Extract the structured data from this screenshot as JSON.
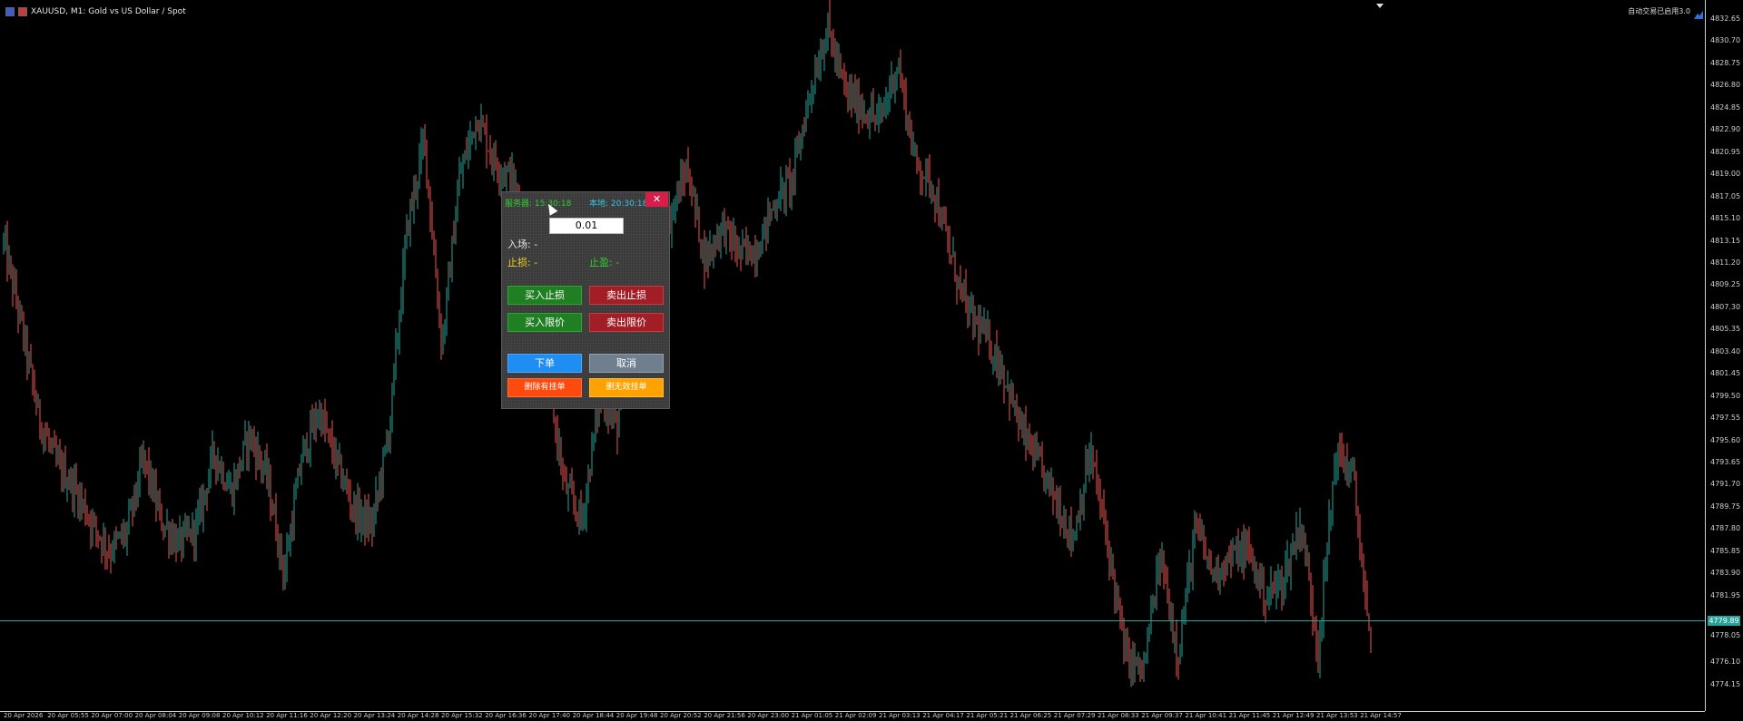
{
  "window": {
    "title": "XAUUSD, M1:  Gold vs US Dollar / Spot"
  },
  "toolbar": {
    "right_label": "自动交易已启用3.0"
  },
  "colors": {
    "bull": "#26a69a",
    "bear": "#ef5350",
    "price_line": "#2aa198",
    "background": "#000000"
  },
  "price_scale": {
    "labels": [
      "4832.65",
      "4830.70",
      "4828.75",
      "4826.80",
      "4824.85",
      "4822.90",
      "4820.95",
      "4819.00",
      "4817.05",
      "4815.10",
      "4813.15",
      "4811.20",
      "4809.25",
      "4807.30",
      "4805.35",
      "4803.40",
      "4801.45",
      "4799.50",
      "4797.55",
      "4795.60",
      "4793.65",
      "4791.70",
      "4789.75",
      "4787.80",
      "4785.85",
      "4783.90",
      "4781.95",
      "4778.05",
      "4776.10",
      "4774.15"
    ],
    "current_price": "4779.89"
  },
  "time_scale": {
    "labels": [
      "20 Apr 2026",
      "20 Apr 05:55",
      "20 Apr 07:00",
      "20 Apr 08:04",
      "20 Apr 09:08",
      "20 Apr 10:12",
      "20 Apr 11:16",
      "20 Apr 12:20",
      "20 Apr 13:24",
      "20 Apr 14:28",
      "20 Apr 15:32",
      "20 Apr 16:36",
      "20 Apr 17:40",
      "20 Apr 18:44",
      "20 Apr 19:48",
      "20 Apr 20:52",
      "20 Apr 21:56",
      "20 Apr 23:00",
      "21 Apr 01:05",
      "21 Apr 02:09",
      "21 Apr 03:13",
      "21 Apr 04:17",
      "21 Apr 05:21",
      "21 Apr 06:25",
      "21 Apr 07:29",
      "21 Apr 08:33",
      "21 Apr 09:37",
      "21 Apr 10:41",
      "21 Apr 11:45",
      "21 Apr 12:49",
      "21 Apr 13:53",
      "21 Apr 14:57"
    ]
  },
  "chart_data": {
    "type": "candlestick",
    "symbol": "XAUUSD",
    "timeframe": "M1",
    "ylim": [
      4773.0,
      4833.5
    ],
    "current_price": 4779.89,
    "close_path": [
      4813.0,
      4806.0,
      4798.0,
      4794.0,
      4792.0,
      4789.0,
      4786.5,
      4788.0,
      4794.5,
      4789.0,
      4787.0,
      4788.5,
      4795.0,
      4791.5,
      4796.5,
      4793.0,
      4784.5,
      4794.5,
      4798.5,
      4794.0,
      4790.0,
      4788.5,
      4797.0,
      4814.0,
      4822.0,
      4804.0,
      4818.5,
      4824.0,
      4820.0,
      4818.5,
      4812.0,
      4802.0,
      4792.0,
      4789.0,
      4800.0,
      4797.0,
      4811.0,
      4812.5,
      4815.0,
      4819.5,
      4811.5,
      4814.5,
      4812.0,
      4812.5,
      4816.5,
      4818.5,
      4826.0,
      4831.5,
      4826.0,
      4824.5,
      4823.5,
      4828.5,
      4820.0,
      4818.0,
      4812.0,
      4807.0,
      4805.0,
      4802.0,
      4797.0,
      4794.0,
      4791.0,
      4787.5,
      4795.0,
      4787.0,
      4777.5,
      4776.0,
      4786.0,
      4777.5,
      4788.5,
      4784.5,
      4786.0,
      4786.5,
      4782.5,
      4784.0,
      4789.0,
      4778.0,
      4795.0,
      4793.0,
      4777.0
    ]
  },
  "panel": {
    "server_time": "服务器: 15:30:18",
    "local_time": "本地: 20:30:18",
    "close_label": "✕",
    "lot_value": "0.01",
    "entry_label": "入场: -",
    "sl_label": "止损: -",
    "tp_label": "止盈: -",
    "buy_stop": "买入止损",
    "sell_stop": "卖出止损",
    "buy_limit": "买入限价",
    "sell_limit": "卖出限价",
    "place_order": "下单",
    "cancel": "取消",
    "delete_pending": "删除有挂单",
    "delete_all_pending": "删无效挂单"
  }
}
